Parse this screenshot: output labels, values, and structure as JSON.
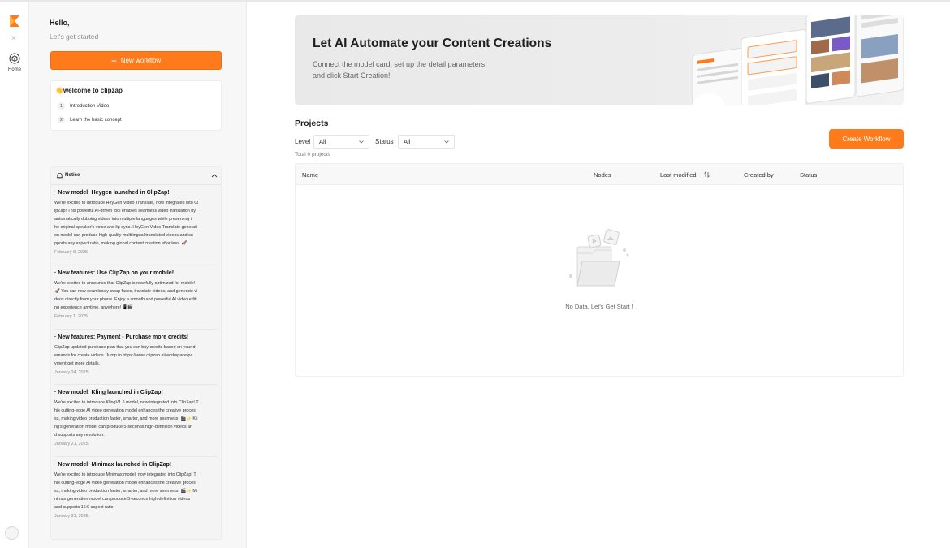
{
  "rail": {
    "close_glyph": "×",
    "home_label": "Home"
  },
  "sidebar": {
    "greeting": "Hello,",
    "subtitle": "Let's get started",
    "new_workflow_label": "New workflow",
    "welcome": {
      "title": "👋welcome to clipzap",
      "items": [
        {
          "num": "1",
          "label": "Introduction Video"
        },
        {
          "num": "2",
          "label": "Learn the basic concept"
        }
      ]
    },
    "notice": {
      "title": "Notice",
      "items": [
        {
          "title": "· New model: Heygen launched in ClipZap!",
          "lines": [
            "We're excited to introduce HeyGen Video Translate, now integrated into Cl",
            "ipZap! This powerful AI-driven tool enables seamless video translation by",
            "automatically dubbing videos into multiple languages while preserving t",
            "he original speaker's voice and lip sync. HeyGen Video Translate generati",
            "on model can produce high-quality multilingual translated videos and su",
            "pports any aspect ratio, making global content creation effortless. 🚀"
          ],
          "date": "February 8, 2025"
        },
        {
          "title": "· New features: Use ClipZap on your mobile!",
          "lines": [
            "We're excited to announce that ClipZap is now fully optimized for mobile!",
            "🚀 You can now seamlessly swap faces, translate videos, and generate vi",
            "deos directly from your phone. Enjoy a smooth and powerful AI video editi",
            "ng experience anytime, anywhere! 📱🎬"
          ],
          "date": "February 1, 2025"
        },
        {
          "title": "· New features: Payment - Purchase more credits!",
          "lines": [
            "ClipZap updated purchase plan that you can buy credits based on your d",
            "emands for create videos. Jump to https://www.clipzap.ai/workspace/pa",
            "yment get more details."
          ],
          "date": "January 24, 2025"
        },
        {
          "title": "· New model: Kling launched in ClipZap!",
          "lines": [
            "We're excited to introduce KlingV1.6 model, now integrated into ClipZap! T",
            "his cutting-edge AI video generation model enhances the creative proces",
            "ss, making video production faster, smarter, and more seamless. 🎬✨ Kli",
            "ng's generation model can produce 5-seconds high-definition videos an",
            "d supports any resolution."
          ],
          "date": "January 21, 2025"
        },
        {
          "title": "· New model: Minimax launched in ClipZap!",
          "lines": [
            "We're excited to introduce Minimax model, now integrated into ClipZap! T",
            "his cutting-edge AI video generation model enhances the creative proces",
            "ss, making video production faster, smarter, and more seamless. 🎬✨ Mi",
            "nimax generation model can produce 5-seconds high-definition videos",
            "and supports 16:9 aspect ratio."
          ],
          "date": "January 31, 2025"
        }
      ]
    }
  },
  "banner": {
    "title": "Let AI Automate your Content Creations",
    "subtitle_line1": "Connect the model card, set up the detail parameters,",
    "subtitle_line2": "and click Start Creation!"
  },
  "projects": {
    "title": "Projects",
    "level_label": "Level",
    "level_value": "All",
    "status_label": "Status",
    "status_value": "All",
    "total_text": "Total 0 projects",
    "create_button": "Create Workflow",
    "columns": [
      "Name",
      "Nodes",
      "Last modified",
      "Created by",
      "Status"
    ],
    "empty_text": "No Data, Let's Get Start !"
  },
  "colors": {
    "accent": "#ff7a1a",
    "panel_bg": "#f7f7f8",
    "banner_bg": "#ebebec"
  },
  "icons": [
    "logo-icon",
    "close-icon",
    "home-icon",
    "plus-icon",
    "bell-icon",
    "chevron-up-icon",
    "chevron-down-icon",
    "sort-icon",
    "empty-folder-icon",
    "avatar-icon"
  ]
}
